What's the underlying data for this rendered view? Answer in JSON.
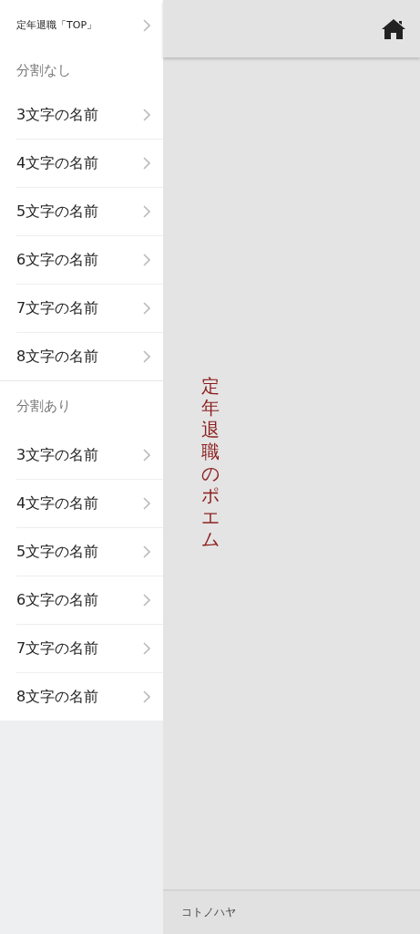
{
  "sidebar": {
    "top_link": {
      "label": "定年退職「TOP」"
    },
    "sections": [
      {
        "title": "分割なし",
        "items": [
          {
            "label": "3文字の名前"
          },
          {
            "label": "4文字の名前"
          },
          {
            "label": "5文字の名前"
          },
          {
            "label": "6文字の名前"
          },
          {
            "label": "7文字の名前"
          },
          {
            "label": "8文字の名前"
          }
        ]
      },
      {
        "title": "分割あり",
        "items": [
          {
            "label": "3文字の名前"
          },
          {
            "label": "4文字の名前"
          },
          {
            "label": "5文字の名前"
          },
          {
            "label": "6文字の名前"
          },
          {
            "label": "7文字の名前"
          },
          {
            "label": "8文字の名前"
          }
        ]
      }
    ]
  },
  "main": {
    "vertical_title": "定年退職のポエム"
  },
  "footer": {
    "text": "コトノハヤ"
  }
}
